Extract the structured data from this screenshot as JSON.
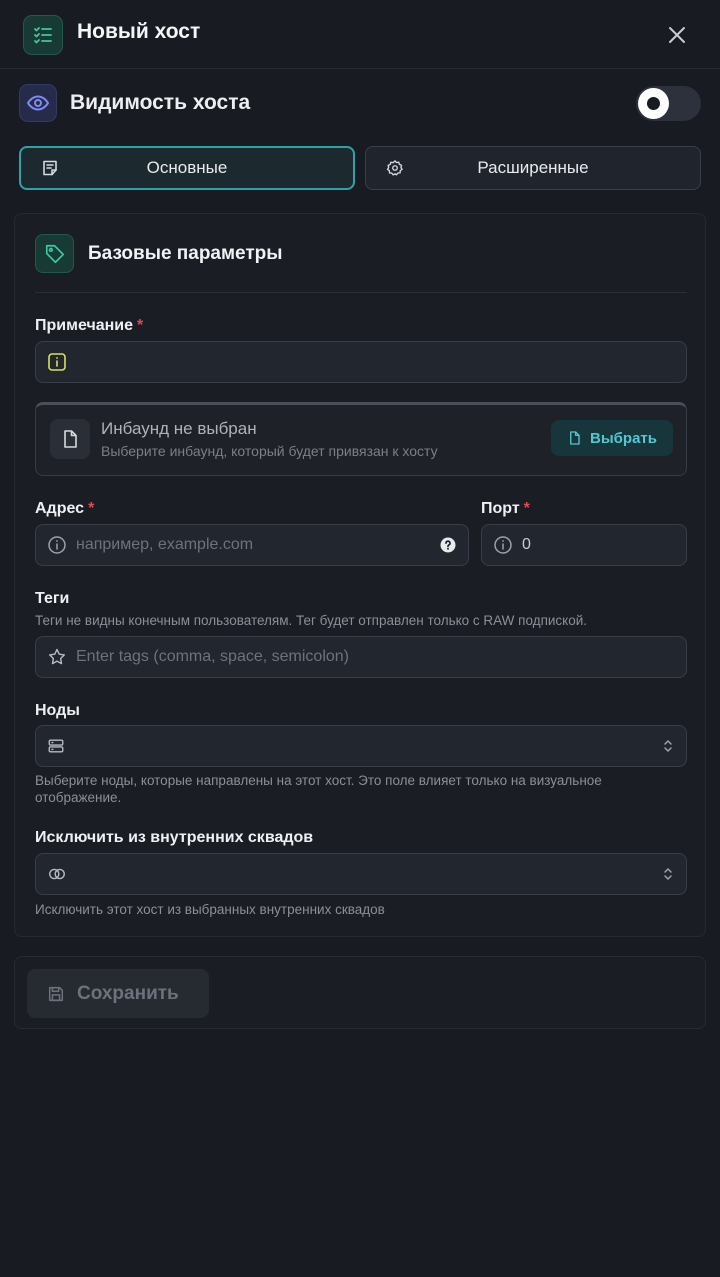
{
  "header": {
    "title": "Новый хост"
  },
  "visibility": {
    "title": "Видимость хоста",
    "enabled": false
  },
  "tabs": [
    {
      "label": "Основные",
      "active": true
    },
    {
      "label": "Расширенные",
      "active": false
    }
  ],
  "basic": {
    "title": "Базовые параметры",
    "remark": {
      "label": "Примечание",
      "required_mark": "*",
      "value": ""
    },
    "inbound": {
      "title": "Инбаунд не выбран",
      "subtitle": "Выберите инбаунд, который будет привязан к хосту",
      "button": "Выбрать"
    },
    "address": {
      "label": "Адрес",
      "required_mark": "*",
      "placeholder": "например, example.com"
    },
    "port": {
      "label": "Порт",
      "required_mark": "*",
      "value": "0"
    },
    "tags": {
      "label": "Теги",
      "hint": "Теги не видны конечным пользователям. Тег будет отправлен только с RAW подпиской.",
      "placeholder": "Enter tags (comma, space, semicolon)"
    },
    "nodes": {
      "label": "Ноды",
      "hint": "Выберите ноды, которые направлены на этот хост. Это поле влияет только на визуальное отображение."
    },
    "exclude": {
      "label": "Исключить из внутренних сквадов",
      "hint": "Исключить этот хост из выбранных внутренних сквадов"
    }
  },
  "save": {
    "label": "Сохранить"
  },
  "colors": {
    "background": "#181b22",
    "accent_teal": "#2ba3a8",
    "required": "#e5484d"
  }
}
